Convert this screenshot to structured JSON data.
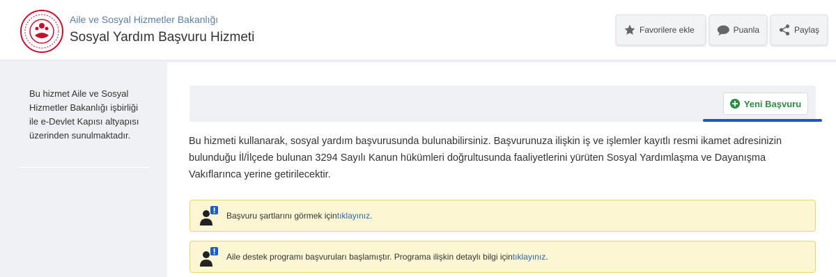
{
  "header": {
    "ministry": "Aile ve Sosyal Hizmetler Bakanlığı",
    "title": "Sosyal Yardım Başvuru Hizmeti",
    "buttons": {
      "favorites": "Favorilere ekle",
      "rate": "Puanla",
      "share": "Paylaş"
    }
  },
  "sidebar": {
    "info": "Bu hizmet Aile ve Sosyal Hizmetler Bakanlığı işbirliği ile e-Devlet Kapısı altyapısı üzerinden sunulmaktadır."
  },
  "main": {
    "new_application": "Yeni Başvuru",
    "description": "Bu hizmeti kullanarak, sosyal yardım başvurusunda bulunabilirsiniz. Başvurunuza ilişkin iş ve işlemler kayıtlı resmi ikamet adresinizin bulunduğu İl/İlçede bulunan 3294 Sayılı Kanun hükümleri doğrultusunda faaliyetlerini yürüten Sosyal Yardımlaşma ve Dayanışma Vakıflarınca yerine getirilecektir.",
    "alerts": [
      {
        "text": "Başvuru şartlarını görmek için ",
        "link": "tıklayınız",
        "suffix": "."
      },
      {
        "text": "Aile destek programı başvuruları başlamıştır. Programa ilişkin detaylı bilgi için ",
        "link": "tıklayınız",
        "suffix": "."
      }
    ]
  },
  "colors": {
    "accent_blue": "#1a5ab8",
    "success_green": "#2e8b43",
    "alert_bg": "#fdf6d2",
    "logo_red": "#c8102e"
  },
  "icons": [
    "ministry-logo",
    "star-icon",
    "speech-bubble-icon",
    "share-icon",
    "plus-circle-icon",
    "user-alert-icon"
  ]
}
